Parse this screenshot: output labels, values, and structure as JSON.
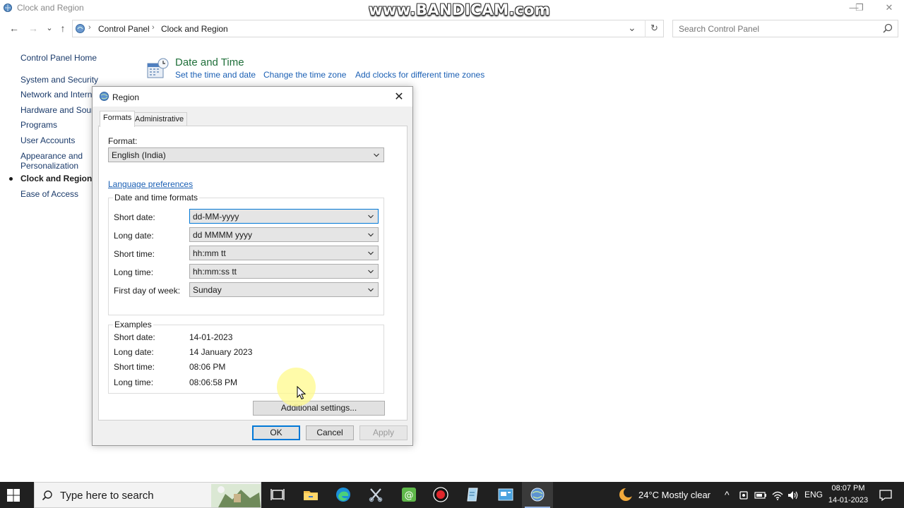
{
  "window": {
    "title": "Clock and Region",
    "watermark": "www.BANDICAM.com",
    "minimize": "—",
    "restore": "❐",
    "close": "✕"
  },
  "nav": {
    "back": "←",
    "forward": "→",
    "recent": "⌄",
    "up": "↑"
  },
  "address": {
    "crumbs": [
      "Control Panel",
      "Clock and Region"
    ],
    "refresh": "↻",
    "dropdown": "⌄"
  },
  "search": {
    "placeholder": "Search Control Panel"
  },
  "sidebar": {
    "items": [
      {
        "label": "Control Panel Home"
      },
      {
        "label": "System and Security"
      },
      {
        "label": "Network and Internet"
      },
      {
        "label": "Hardware and Sound"
      },
      {
        "label": "Programs"
      },
      {
        "label": "User Accounts"
      },
      {
        "label": "Appearance and"
      },
      {
        "label": "Personalization"
      },
      {
        "label": "Clock and Region"
      },
      {
        "label": "Ease of Access"
      }
    ]
  },
  "main": {
    "heading": "Date and Time",
    "links": [
      "Set the time and date",
      "Change the time zone",
      "Add clocks for different time zones"
    ]
  },
  "dialog": {
    "title": "Region",
    "close": "✕",
    "tabs": [
      "Formats",
      "Administrative"
    ],
    "format_label": "Format:",
    "format_value": "English (India)",
    "language_link": "Language preferences",
    "dt_group": "Date and time formats",
    "fields": [
      {
        "label": "Short date:",
        "value": "dd-MM-yyyy"
      },
      {
        "label": "Long date:",
        "value": "dd MMMM yyyy"
      },
      {
        "label": "Short time:",
        "value": "hh:mm tt"
      },
      {
        "label": "Long time:",
        "value": "hh:mm:ss tt"
      },
      {
        "label": "First day of week:",
        "value": "Sunday"
      }
    ],
    "examples_group": "Examples",
    "examples": [
      {
        "label": "Short date:",
        "value": "14-01-2023"
      },
      {
        "label": "Long date:",
        "value": "14 January 2023"
      },
      {
        "label": "Short time:",
        "value": "08:06 PM"
      },
      {
        "label": "Long time:",
        "value": "08:06:58 PM"
      }
    ],
    "additional": "Additional settings...",
    "ok": "OK",
    "cancel": "Cancel",
    "apply": "Apply"
  },
  "taskbar": {
    "search_placeholder": "Type here to search",
    "weather": "24°C  Mostly clear",
    "chevron": "^",
    "lang": "ENG",
    "time": "08:07 PM",
    "date": "14-01-2023"
  },
  "colors": {
    "accent": "#0078d7",
    "link": "#1a5fb4",
    "heading_green": "#1f6f3a",
    "taskbar": "#202020"
  }
}
